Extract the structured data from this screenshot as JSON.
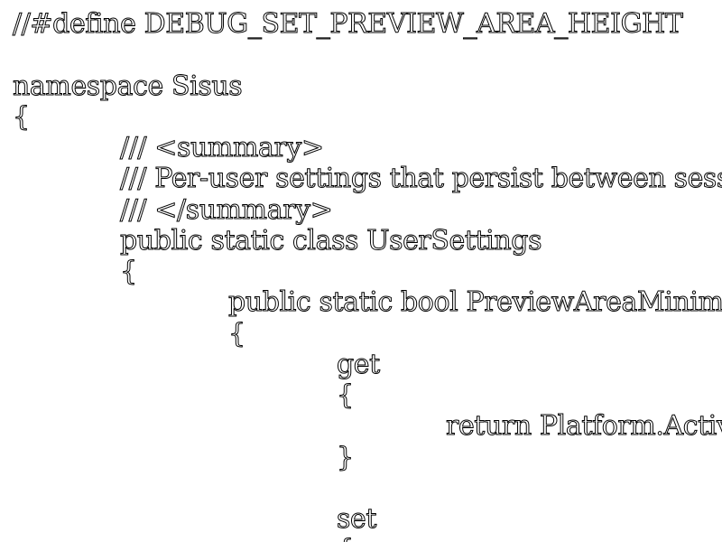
{
  "lines": [
    {
      "text": "//#define DEBUG_SET_PREVIEW_AREA_HEIGHT",
      "indent": 0
    },
    {
      "text": "",
      "indent": 0
    },
    {
      "text": "namespace Sisus",
      "indent": 0
    },
    {
      "text": "{",
      "indent": 0
    },
    {
      "text": "/// <summary>",
      "indent": 1
    },
    {
      "text": "/// Per-user settings that persist between sessio",
      "indent": 1
    },
    {
      "text": "/// </summary>",
      "indent": 1
    },
    {
      "text": "public static class UserSettings",
      "indent": 1
    },
    {
      "text": "{",
      "indent": 1
    },
    {
      "text": "public static bool PreviewAreaMinimiz",
      "indent": 2
    },
    {
      "text": "{",
      "indent": 2
    },
    {
      "text": "get",
      "indent": 3
    },
    {
      "text": "{",
      "indent": 3
    },
    {
      "text": "return Platform.Active",
      "indent": 4
    },
    {
      "text": "}",
      "indent": 3
    },
    {
      "text": "",
      "indent": 0
    },
    {
      "text": "set",
      "indent": 3
    },
    {
      "text": "{",
      "indent": 3
    }
  ]
}
